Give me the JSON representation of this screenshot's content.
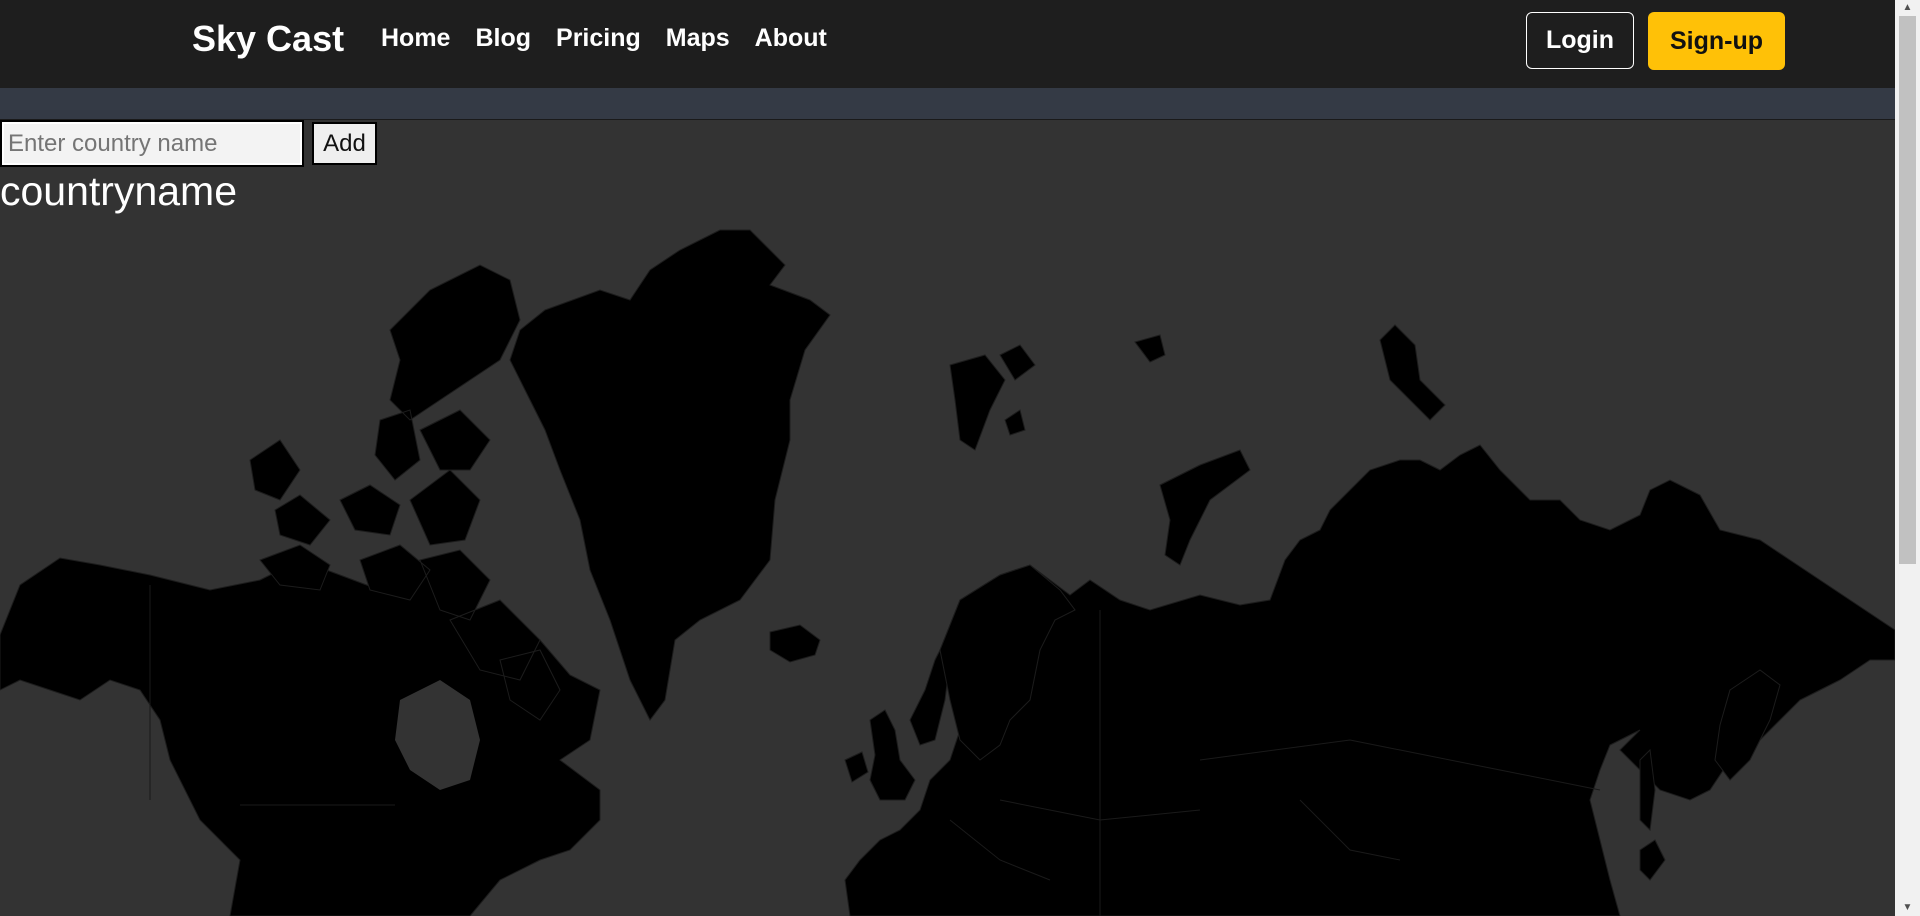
{
  "navbar": {
    "brand": "Sky Cast",
    "links": [
      "Home",
      "Blog",
      "Pricing",
      "Maps",
      "About"
    ],
    "login_label": "Login",
    "signup_label": "Sign-up"
  },
  "country_form": {
    "placeholder": "Enter country name",
    "value": "",
    "add_label": "Add"
  },
  "country_title": "countryname",
  "colors": {
    "background": "#333333",
    "navbar": "#1e1e1e",
    "land": "#000000",
    "accent": "#ffc107"
  },
  "map": {
    "icon": "world-map",
    "projection": "mercator"
  },
  "scrollbar": {
    "up_icon": "triangle-up",
    "down_icon": "triangle-down"
  }
}
